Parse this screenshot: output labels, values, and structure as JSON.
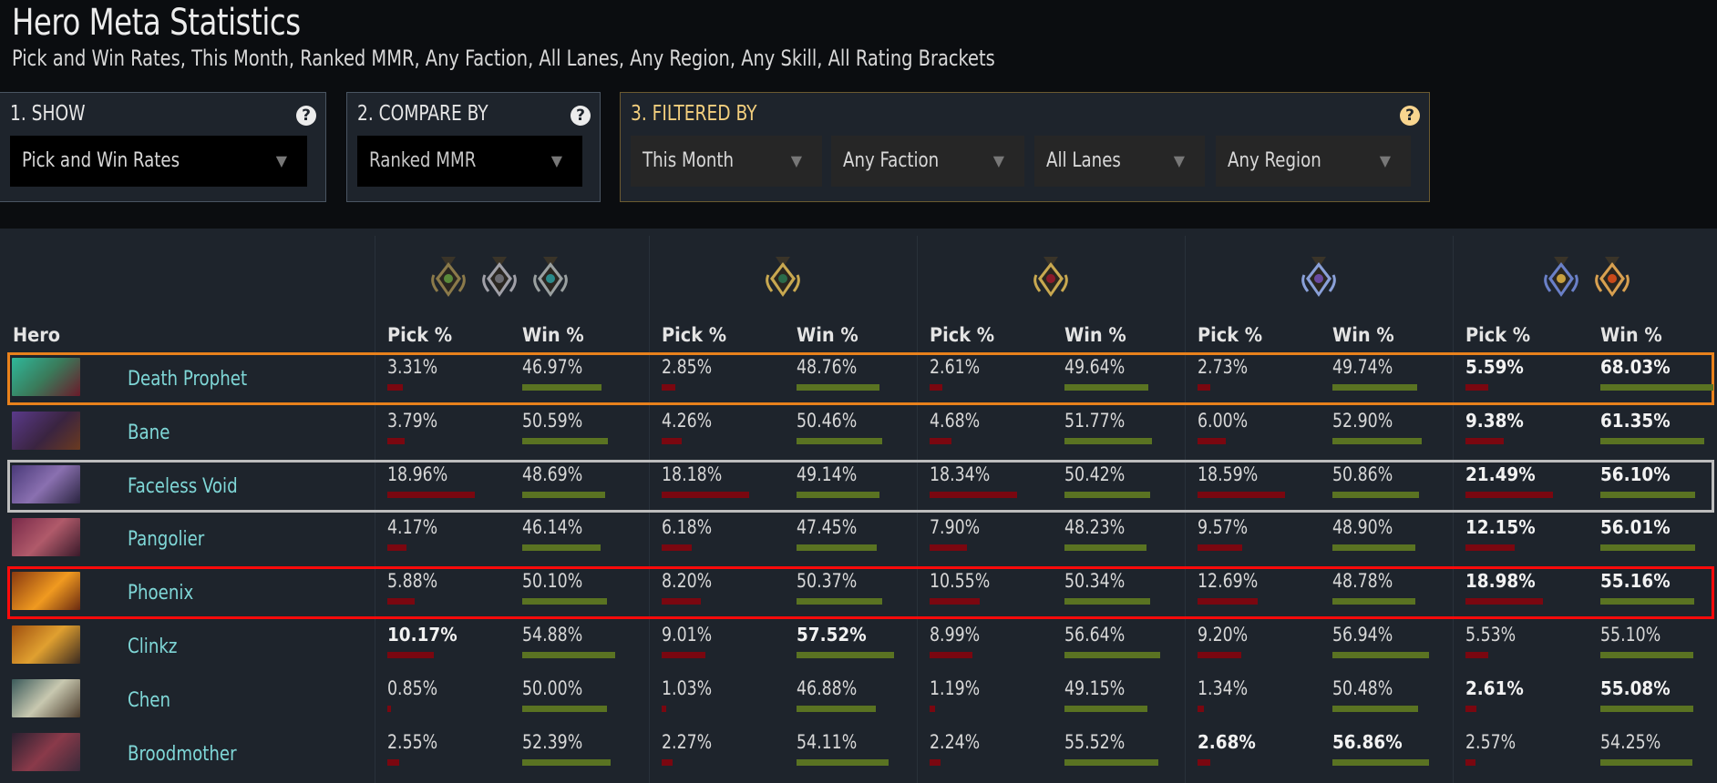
{
  "header": {
    "title": "Hero Meta Statistics",
    "subtitle": "Pick and Win Rates, This Month, Ranked MMR, Any Faction, All Lanes, Any Region, Any Skill, All Rating Brackets"
  },
  "panels": {
    "show": {
      "title": "1. SHOW",
      "help_icon": "question-circle-icon",
      "selected": "Pick and Win Rates"
    },
    "compare_by": {
      "title": "2. COMPARE BY",
      "help_icon": "question-circle-icon",
      "selected": "Ranked MMR"
    },
    "filtered_by": {
      "title": "3. FILTERED BY",
      "help_icon": "question-circle-icon",
      "filters": [
        "This Month",
        "Any Faction",
        "All Lanes",
        "Any Region"
      ]
    }
  },
  "colors": {
    "pick_bar": "#7a0710",
    "win_bar": "#5a7322",
    "hero_name": "#7fd7d7",
    "highlight_orange": "#e8811c",
    "highlight_gray": "#bdbdbd",
    "highlight_red": "#ff0a0a",
    "filter_title": "#f3cf7e"
  },
  "table": {
    "hero_header": "Hero",
    "pick_header": "Pick %",
    "win_header": "Win %",
    "brackets": [
      {
        "name": "Herald / Guardian / Crusader",
        "medals": [
          "herald-medal-icon",
          "guardian-medal-icon",
          "crusader-medal-icon"
        ]
      },
      {
        "name": "Archon",
        "medals": [
          "archon-medal-icon"
        ]
      },
      {
        "name": "Legend",
        "medals": [
          "legend-medal-icon"
        ]
      },
      {
        "name": "Ancient",
        "medals": [
          "ancient-medal-icon"
        ]
      },
      {
        "name": "Divine / Immortal",
        "medals": [
          "divine-medal-icon",
          "immortal-medal-icon"
        ]
      }
    ],
    "rows": [
      {
        "hero": "Death Prophet",
        "highlight": "orange",
        "portrait": "death-prophet-portrait",
        "cells": [
          {
            "pick": "3.31%",
            "win": "46.97%",
            "pick_bold": false,
            "win_bold": false
          },
          {
            "pick": "2.85%",
            "win": "48.76%",
            "pick_bold": false,
            "win_bold": false
          },
          {
            "pick": "2.61%",
            "win": "49.64%",
            "pick_bold": false,
            "win_bold": false
          },
          {
            "pick": "2.73%",
            "win": "49.74%",
            "pick_bold": false,
            "win_bold": false
          },
          {
            "pick": "5.59%",
            "win": "68.03%",
            "pick_bold": true,
            "win_bold": true
          }
        ]
      },
      {
        "hero": "Bane",
        "highlight": "",
        "portrait": "bane-portrait",
        "cells": [
          {
            "pick": "3.79%",
            "win": "50.59%",
            "pick_bold": false,
            "win_bold": false
          },
          {
            "pick": "4.26%",
            "win": "50.46%",
            "pick_bold": false,
            "win_bold": false
          },
          {
            "pick": "4.68%",
            "win": "51.77%",
            "pick_bold": false,
            "win_bold": false
          },
          {
            "pick": "6.00%",
            "win": "52.90%",
            "pick_bold": false,
            "win_bold": false
          },
          {
            "pick": "9.38%",
            "win": "61.35%",
            "pick_bold": true,
            "win_bold": true
          }
        ]
      },
      {
        "hero": "Faceless Void",
        "highlight": "gray",
        "portrait": "faceless-void-portrait",
        "cells": [
          {
            "pick": "18.96%",
            "win": "48.69%",
            "pick_bold": false,
            "win_bold": false
          },
          {
            "pick": "18.18%",
            "win": "49.14%",
            "pick_bold": false,
            "win_bold": false
          },
          {
            "pick": "18.34%",
            "win": "50.42%",
            "pick_bold": false,
            "win_bold": false
          },
          {
            "pick": "18.59%",
            "win": "50.86%",
            "pick_bold": false,
            "win_bold": false
          },
          {
            "pick": "21.49%",
            "win": "56.10%",
            "pick_bold": true,
            "win_bold": true
          }
        ]
      },
      {
        "hero": "Pangolier",
        "highlight": "",
        "portrait": "pangolier-portrait",
        "cells": [
          {
            "pick": "4.17%",
            "win": "46.14%",
            "pick_bold": false,
            "win_bold": false
          },
          {
            "pick": "6.18%",
            "win": "47.45%",
            "pick_bold": false,
            "win_bold": false
          },
          {
            "pick": "7.90%",
            "win": "48.23%",
            "pick_bold": false,
            "win_bold": false
          },
          {
            "pick": "9.57%",
            "win": "48.90%",
            "pick_bold": false,
            "win_bold": false
          },
          {
            "pick": "12.15%",
            "win": "56.01%",
            "pick_bold": true,
            "win_bold": true
          }
        ]
      },
      {
        "hero": "Phoenix",
        "highlight": "red",
        "portrait": "phoenix-portrait",
        "cells": [
          {
            "pick": "5.88%",
            "win": "50.10%",
            "pick_bold": false,
            "win_bold": false
          },
          {
            "pick": "8.20%",
            "win": "50.37%",
            "pick_bold": false,
            "win_bold": false
          },
          {
            "pick": "10.55%",
            "win": "50.34%",
            "pick_bold": false,
            "win_bold": false
          },
          {
            "pick": "12.69%",
            "win": "48.78%",
            "pick_bold": false,
            "win_bold": false
          },
          {
            "pick": "18.98%",
            "win": "55.16%",
            "pick_bold": true,
            "win_bold": true
          }
        ]
      },
      {
        "hero": "Clinkz",
        "highlight": "",
        "portrait": "clinkz-portrait",
        "cells": [
          {
            "pick": "10.17%",
            "win": "54.88%",
            "pick_bold": true,
            "win_bold": false
          },
          {
            "pick": "9.01%",
            "win": "57.52%",
            "pick_bold": false,
            "win_bold": true
          },
          {
            "pick": "8.99%",
            "win": "56.64%",
            "pick_bold": false,
            "win_bold": false
          },
          {
            "pick": "9.20%",
            "win": "56.94%",
            "pick_bold": false,
            "win_bold": false
          },
          {
            "pick": "5.53%",
            "win": "55.10%",
            "pick_bold": false,
            "win_bold": false
          }
        ]
      },
      {
        "hero": "Chen",
        "highlight": "",
        "portrait": "chen-portrait",
        "cells": [
          {
            "pick": "0.85%",
            "win": "50.00%",
            "pick_bold": false,
            "win_bold": false
          },
          {
            "pick": "1.03%",
            "win": "46.88%",
            "pick_bold": false,
            "win_bold": false
          },
          {
            "pick": "1.19%",
            "win": "49.15%",
            "pick_bold": false,
            "win_bold": false
          },
          {
            "pick": "1.34%",
            "win": "50.48%",
            "pick_bold": false,
            "win_bold": false
          },
          {
            "pick": "2.61%",
            "win": "55.08%",
            "pick_bold": true,
            "win_bold": true
          }
        ]
      },
      {
        "hero": "Broodmother",
        "highlight": "",
        "portrait": "broodmother-portrait",
        "cells": [
          {
            "pick": "2.55%",
            "win": "52.39%",
            "pick_bold": false,
            "win_bold": false
          },
          {
            "pick": "2.27%",
            "win": "54.11%",
            "pick_bold": false,
            "win_bold": false
          },
          {
            "pick": "2.24%",
            "win": "55.52%",
            "pick_bold": false,
            "win_bold": false
          },
          {
            "pick": "2.68%",
            "win": "56.86%",
            "pick_bold": true,
            "win_bold": true
          },
          {
            "pick": "2.57%",
            "win": "54.25%",
            "pick_bold": false,
            "win_bold": false
          }
        ]
      }
    ]
  }
}
